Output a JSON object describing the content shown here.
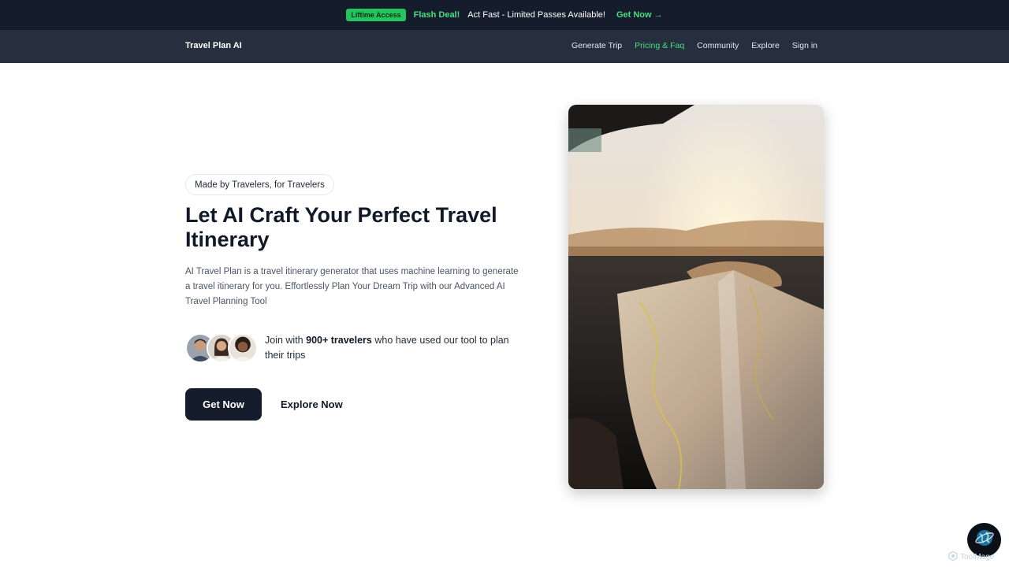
{
  "promo": {
    "badge": "Liftime Access",
    "flash": "Flash Deal!",
    "message": "Act Fast - Limited Passes Available!",
    "cta": "Get Now →"
  },
  "nav": {
    "brand": "Travel Plan AI",
    "links": [
      "Generate Trip",
      "Pricing & Faq",
      "Community",
      "Explore",
      "Sign in"
    ],
    "active_link": "Pricing & Faq"
  },
  "hero": {
    "pill": "Made by Travelers, for Travelers",
    "headline": "Let AI Craft Your Perfect Travel Itinerary",
    "description": "AI Travel Plan is a travel itinerary generator that uses machine learning to generate a travel itinerary for you. Effortlessly Plan Your Dream Trip with our Advanced AI Travel Planning Tool",
    "social_prefix": "Join with",
    "social_count": "900+ travelers",
    "social_suffix": "who have used our tool to plan their trips",
    "primary_button": "Get Now",
    "secondary_button": "Explore Now"
  },
  "watermark": "ToolMage",
  "icons": {
    "fab": "globe-icon",
    "watermark": "toolmage-logo-icon"
  },
  "colors": {
    "promo_bg": "#151c2c",
    "nav_bg": "#262f3d",
    "accent_green": "#4ade80",
    "badge_green": "#22c55e",
    "primary_button": "#151c2c"
  }
}
